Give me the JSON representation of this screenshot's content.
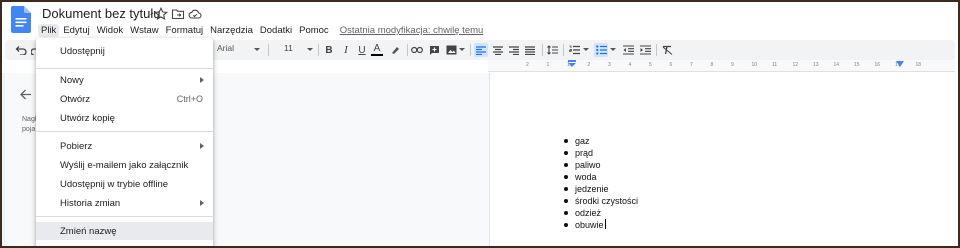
{
  "window": {
    "document_title": "Dokument bez tytułu"
  },
  "icons": {
    "logo": "docs-logo-icon",
    "star": "star-icon",
    "folder": "move-to-folder-icon",
    "cloud": "cloud-saved-icon"
  },
  "menubar": {
    "items": [
      "Plik",
      "Edytuj",
      "Widok",
      "Wstaw",
      "Formatuj",
      "Narzędzia",
      "Dodatki",
      "Pomoc"
    ],
    "active_item": "Plik",
    "last_edit": "Ostatnia modyfikacja: chwilę temu"
  },
  "toolbar": {
    "font": "Arial",
    "font_size": "11",
    "bold": "B",
    "italic": "I",
    "underline": "U",
    "text_color": "A"
  },
  "ruler": {
    "numbers": [
      "2",
      "1",
      "1",
      "2",
      "3",
      "4",
      "5",
      "6",
      "7",
      "8",
      "9",
      "10",
      "11",
      "12",
      "13",
      "14",
      "15",
      "16",
      "17",
      "18"
    ]
  },
  "outline": {
    "text_line1": "Nagł",
    "text_line2": "poja"
  },
  "file_menu": {
    "items": [
      {
        "label": "Udostępnij",
        "shortcut": "",
        "submenu": false
      },
      {
        "label": "Nowy",
        "shortcut": "",
        "submenu": true
      },
      {
        "label": "Otwórz",
        "shortcut": "Ctrl+O",
        "submenu": false
      },
      {
        "label": "Utwórz kopię",
        "shortcut": "",
        "submenu": false
      },
      {
        "label": "Pobierz",
        "shortcut": "",
        "submenu": true
      },
      {
        "label": "Wyślij e-mailem jako załącznik",
        "shortcut": "",
        "submenu": false
      },
      {
        "label": "Udostępnij w trybie offline",
        "shortcut": "",
        "submenu": false
      },
      {
        "label": "Historia zmian",
        "shortcut": "",
        "submenu": true
      },
      {
        "label": "Zmień nazwę",
        "shortcut": "",
        "submenu": false
      }
    ]
  },
  "document": {
    "bullets": [
      "gaz",
      "prąd",
      "paliwo",
      "woda",
      "jedzenie",
      "środki czystości",
      "odzież",
      "obuwie"
    ]
  },
  "colors": {
    "docs_blue": "#4285f4",
    "toolbar_bg": "#f1f3f4",
    "active_toolbar": "#1a73e8",
    "menu_hover": "#e8eaed"
  }
}
